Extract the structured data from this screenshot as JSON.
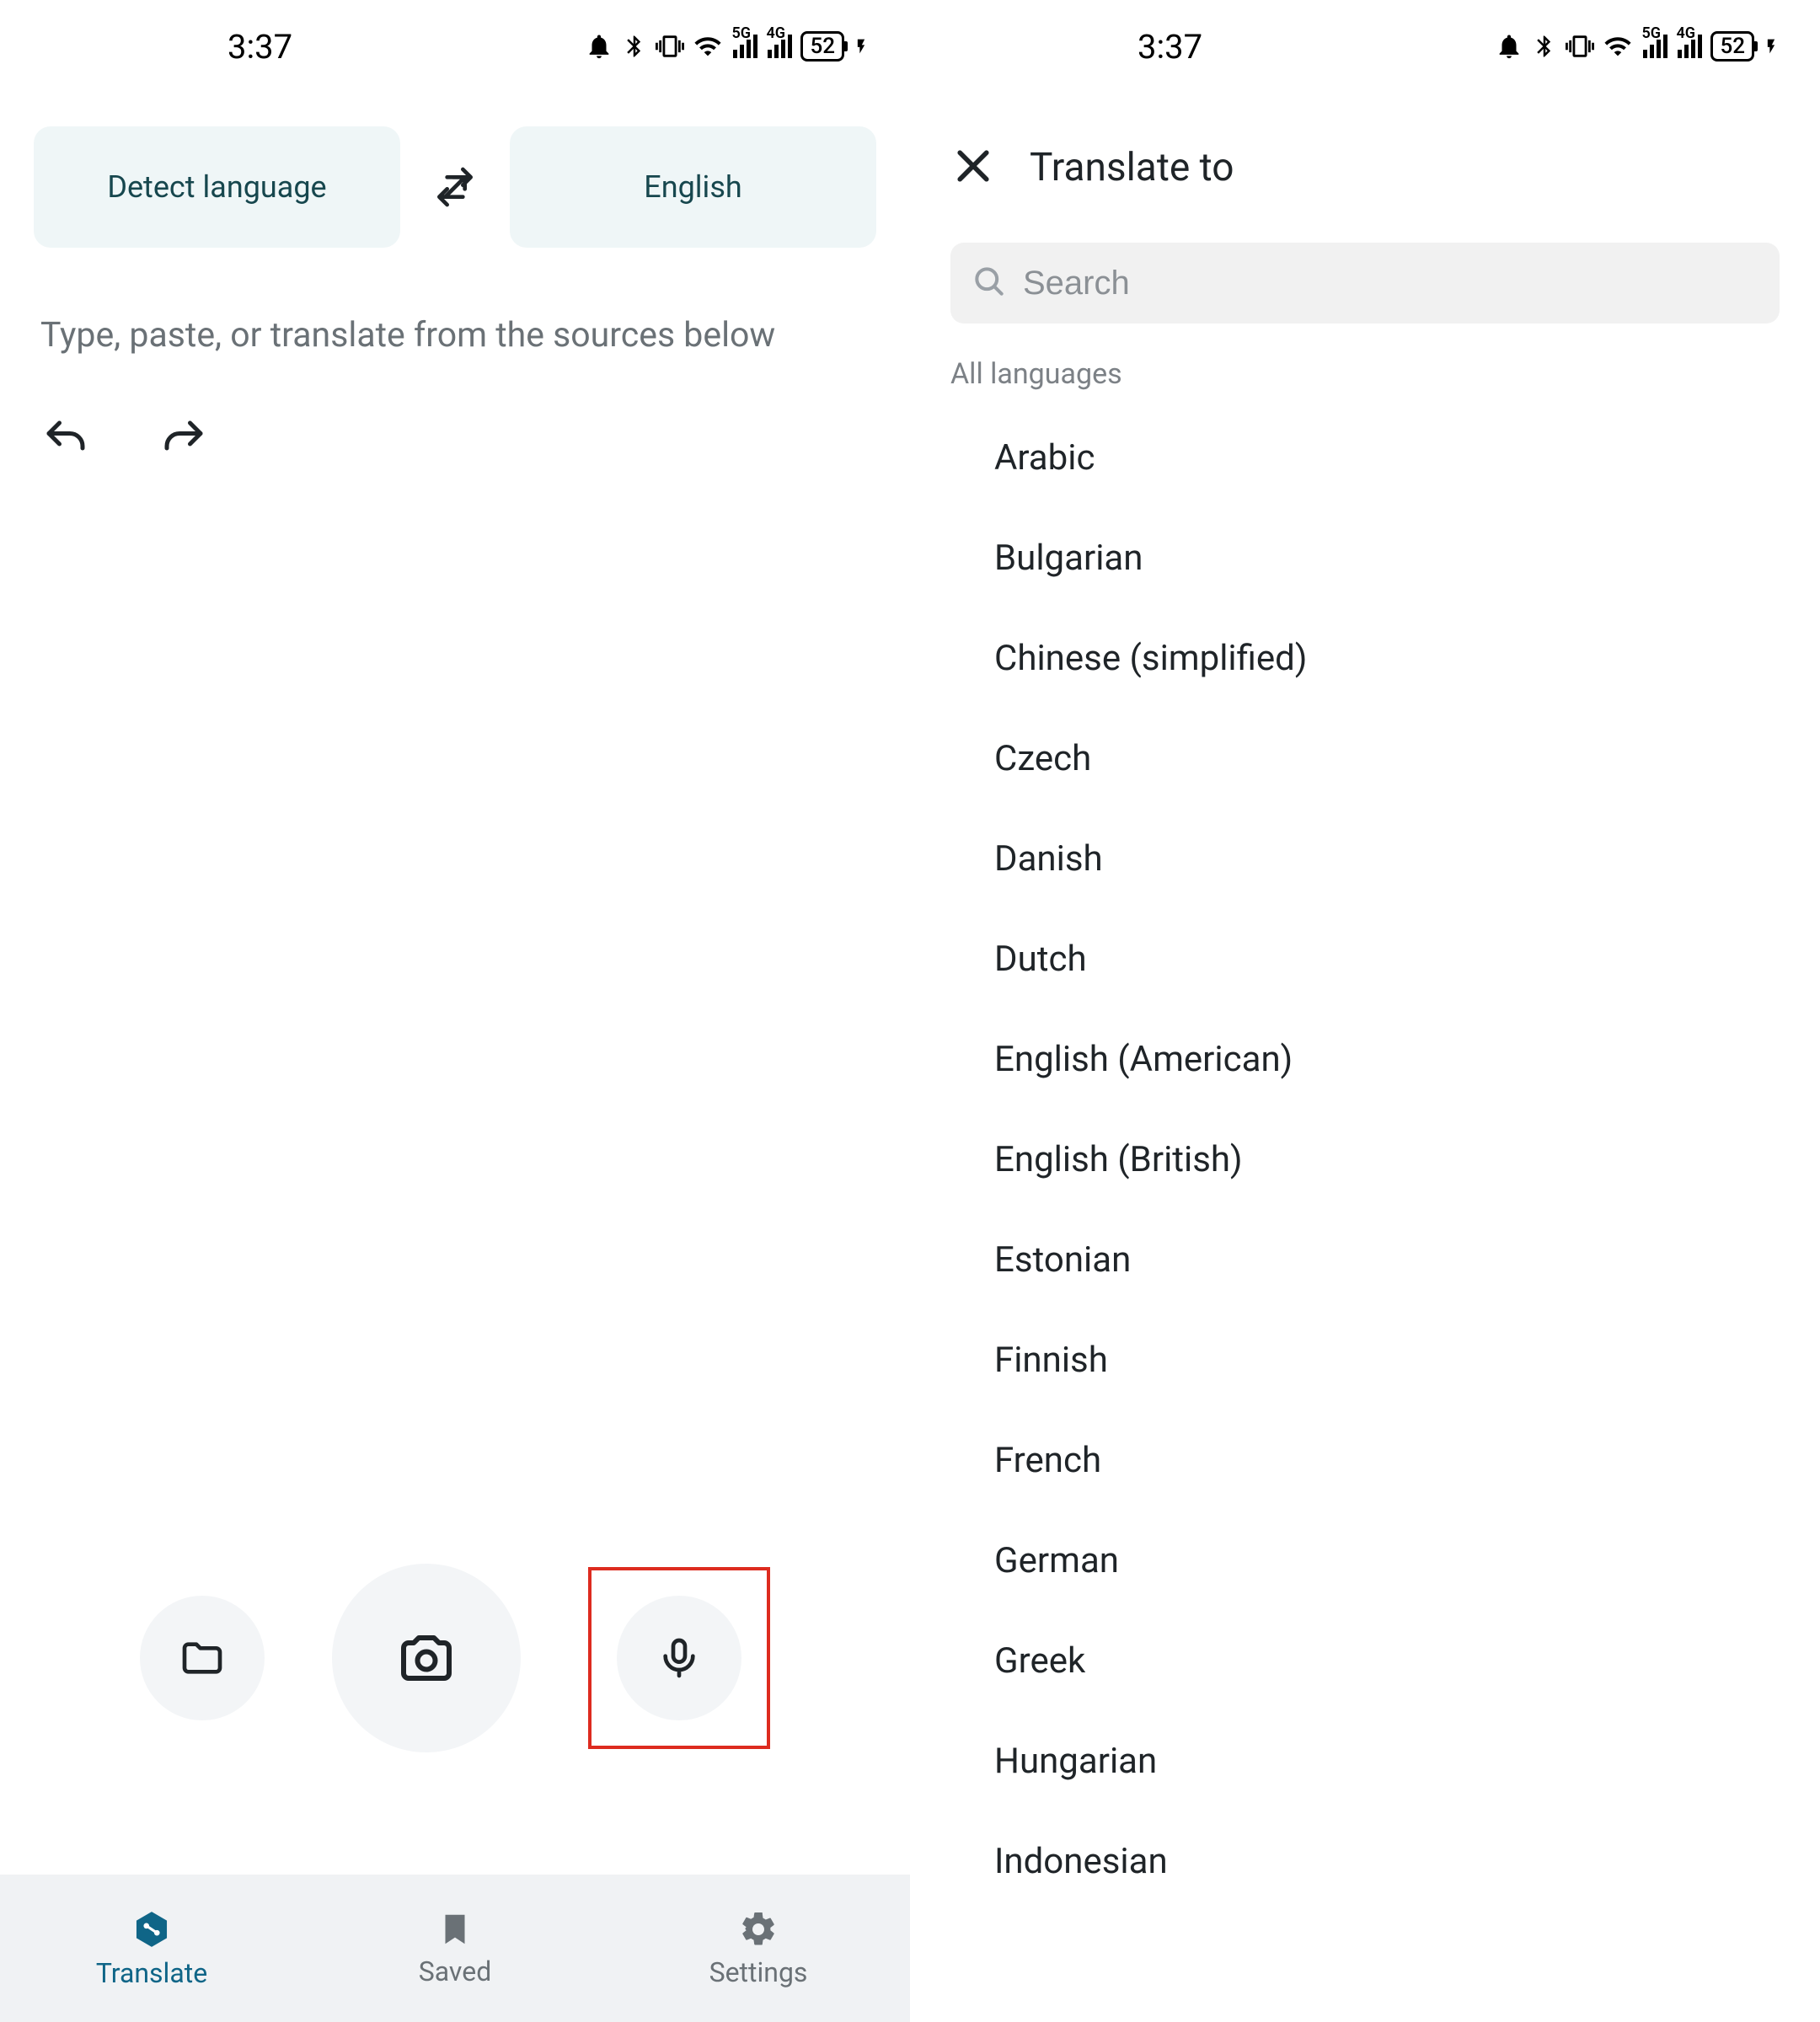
{
  "status": {
    "time": "3:37",
    "battery": "52",
    "network1_label": "5G",
    "network2_label": "4G"
  },
  "left": {
    "source_language": "Detect language",
    "target_language": "English",
    "placeholder": "Type, paste, or translate from the sources below",
    "nav": {
      "translate": "Translate",
      "saved": "Saved",
      "settings": "Settings"
    }
  },
  "right": {
    "title": "Translate to",
    "search_placeholder": "Search",
    "section_label": "All languages",
    "languages": [
      "Arabic",
      "Bulgarian",
      "Chinese (simplified)",
      "Czech",
      "Danish",
      "Dutch",
      "English (American)",
      "English (British)",
      "Estonian",
      "Finnish",
      "French",
      "German",
      "Greek",
      "Hungarian",
      "Indonesian"
    ]
  }
}
